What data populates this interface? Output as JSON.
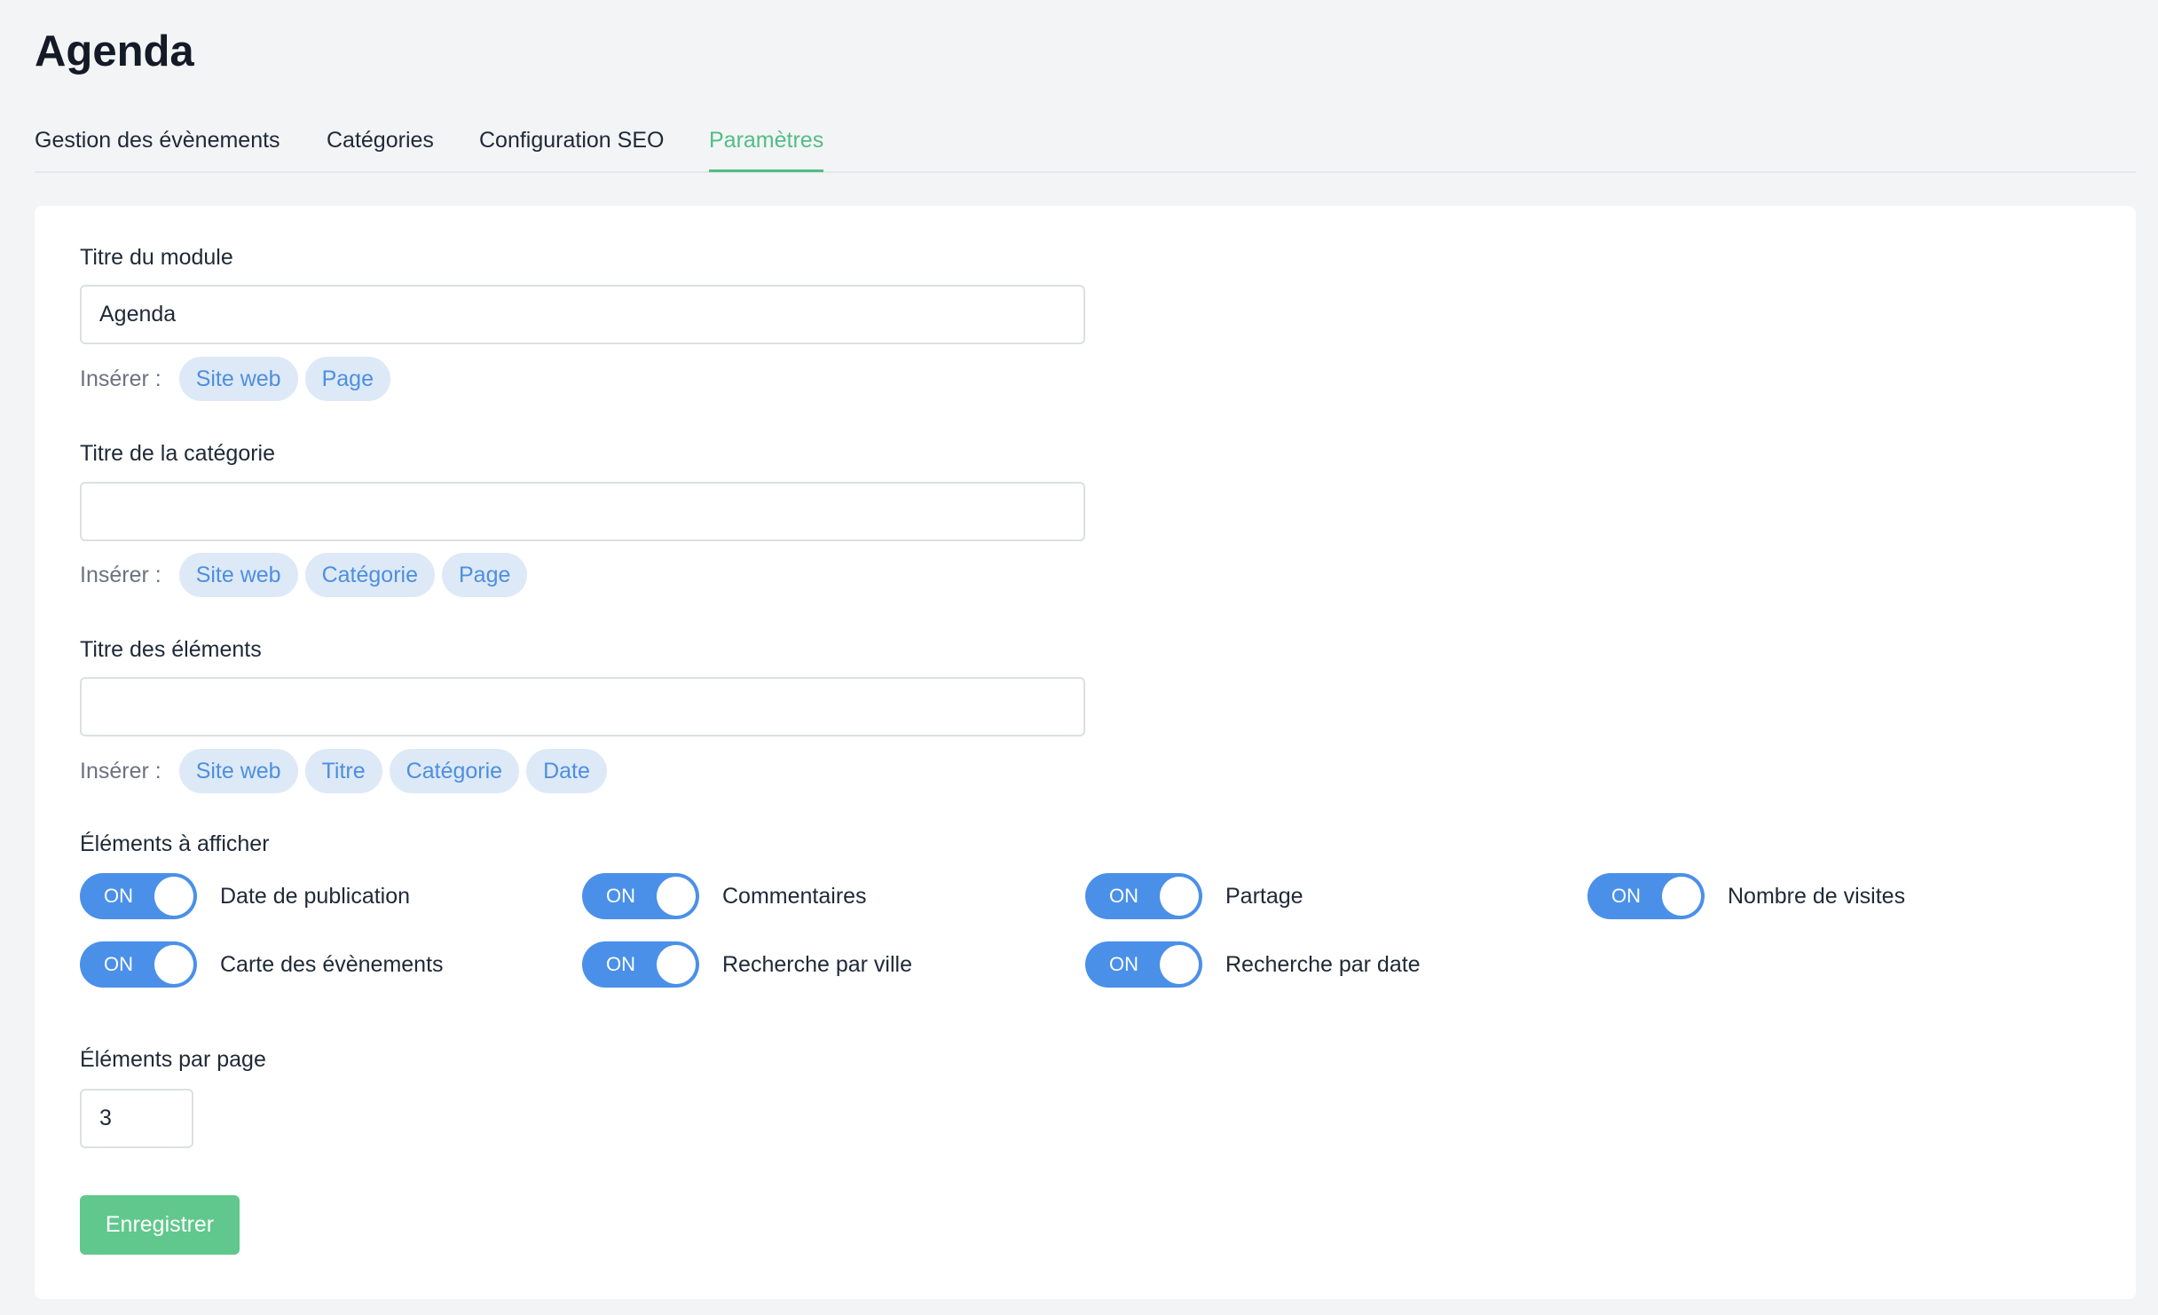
{
  "page_title": "Agenda",
  "tabs": [
    {
      "label": "Gestion des évènements",
      "active": false
    },
    {
      "label": "Catégories",
      "active": false
    },
    {
      "label": "Configuration SEO",
      "active": false
    },
    {
      "label": "Paramètres",
      "active": true
    }
  ],
  "insert_label": "Insérer :",
  "module_title": {
    "label": "Titre du module",
    "value": "Agenda",
    "chips": [
      "Site web",
      "Page"
    ]
  },
  "category_title": {
    "label": "Titre de la catégorie",
    "value": "",
    "chips": [
      "Site web",
      "Catégorie",
      "Page"
    ]
  },
  "elements_title": {
    "label": "Titre des éléments",
    "value": "",
    "chips": [
      "Site web",
      "Titre",
      "Catégorie",
      "Date"
    ]
  },
  "display": {
    "label": "Éléments à afficher",
    "toggle_text": "ON",
    "toggles": [
      {
        "label": "Date de publication",
        "on": true
      },
      {
        "label": "Commentaires",
        "on": true
      },
      {
        "label": "Partage",
        "on": true
      },
      {
        "label": "Nombre de visites",
        "on": true
      },
      {
        "label": "Carte des évènements",
        "on": true
      },
      {
        "label": "Recherche par ville",
        "on": true
      },
      {
        "label": "Recherche par date",
        "on": true
      }
    ]
  },
  "per_page": {
    "label": "Éléments par page",
    "value": "3"
  },
  "save_label": "Enregistrer",
  "colors": {
    "accent_green": "#52bd86",
    "toggle_blue": "#4a90e9",
    "chip_text": "#4d8fde",
    "chip_bg": "#dde9f7",
    "button_green": "#60c88c"
  }
}
